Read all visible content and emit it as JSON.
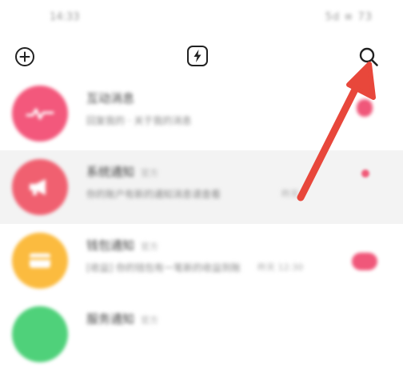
{
  "status_bar": {
    "time": "14:33",
    "indicators": "5d ≡ 73"
  },
  "toolbar": {
    "add_icon": "plus-circle-icon",
    "center_icon": "lightning-bolt-icon",
    "search_icon": "search-icon"
  },
  "annotation": {
    "type": "arrow",
    "target": "search-icon",
    "color": "#e8473b"
  },
  "rows": [
    {
      "title": "互动消息",
      "tag": "",
      "subtitle": "回复我的 · 关于我的消息",
      "time": "",
      "avatar_color": "#f3587c",
      "avatar_icon": "heartbeat-icon",
      "badge": "pill",
      "highlight": false
    },
    {
      "title": "系统通知",
      "tag": "官方",
      "subtitle": "你的账户有新的通知消息请查看",
      "time": "昨天",
      "avatar_color": "#f06070",
      "avatar_icon": "megaphone-icon",
      "badge": "dot",
      "highlight": true
    },
    {
      "title": "钱包通知",
      "tag": "官方",
      "subtitle": "[收益] 你的钱包有一笔新的收益到账",
      "time": "昨天 12:30",
      "avatar_color": "#fbbb3f",
      "avatar_icon": "wallet-icon",
      "badge": "pill",
      "highlight": false
    },
    {
      "title": "服务通知",
      "tag": "官方",
      "subtitle": "",
      "time": "",
      "avatar_color": "#4fd17a",
      "avatar_icon": "service-icon",
      "badge": "none",
      "highlight": false
    }
  ]
}
